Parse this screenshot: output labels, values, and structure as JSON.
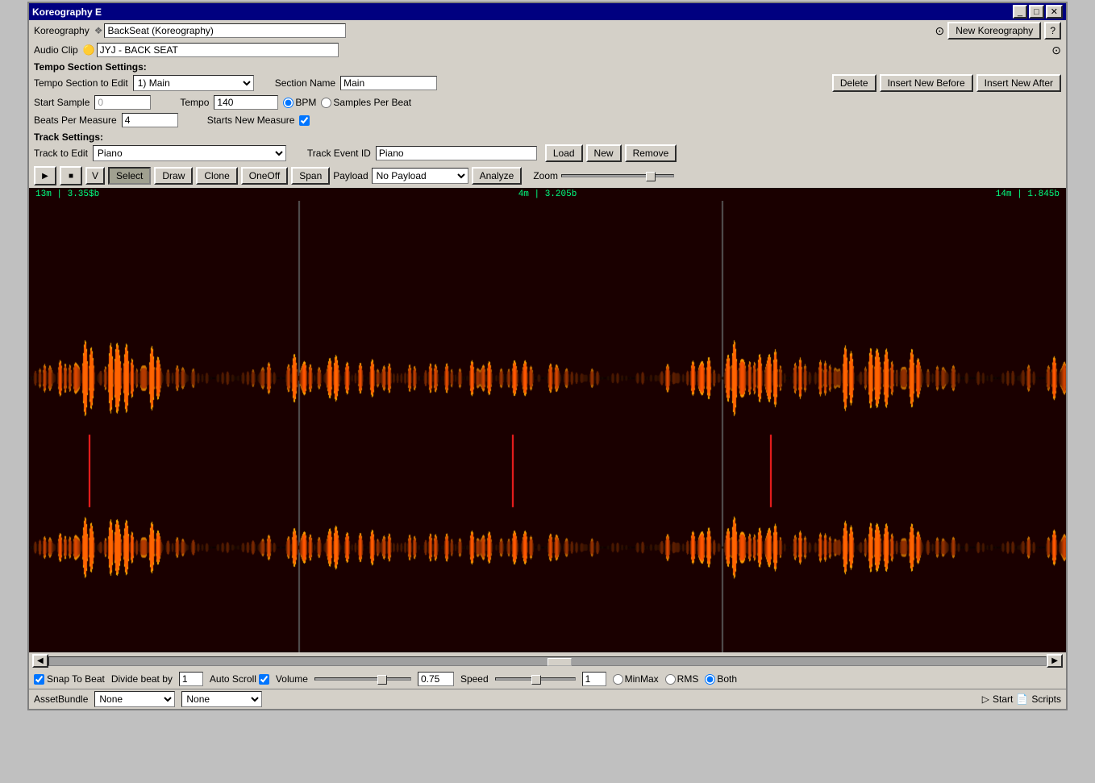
{
  "window": {
    "title": "Koreography E"
  },
  "header": {
    "koreography_label": "Koreography",
    "koreography_value": "BackSeat (Koreography)",
    "audio_clip_label": "Audio Clip",
    "audio_clip_value": "JYJ - BACK SEAT",
    "new_koreography_btn": "New Koreography",
    "question_btn": "?"
  },
  "tempo_section": {
    "title": "Tempo Section Settings:",
    "to_edit_label": "Tempo Section to Edit",
    "to_edit_value": "1) Main",
    "section_name_label": "Section Name",
    "section_name_value": "Main",
    "delete_btn": "Delete",
    "insert_before_btn": "Insert New Before",
    "insert_after_btn": "Insert New After",
    "start_sample_label": "Start Sample",
    "start_sample_value": "0",
    "tempo_label": "Tempo",
    "tempo_value": "140",
    "bpm_radio": "BPM",
    "spb_radio": "Samples Per Beat",
    "beats_per_measure_label": "Beats Per Measure",
    "beats_per_measure_value": "4",
    "starts_new_measure_label": "Starts New Measure",
    "starts_new_measure_checked": true
  },
  "track_settings": {
    "title": "Track Settings:",
    "to_edit_label": "Track to Edit",
    "to_edit_value": "Piano",
    "event_id_label": "Track Event ID",
    "event_id_value": "Piano",
    "load_btn": "Load",
    "new_btn": "New",
    "remove_btn": "Remove"
  },
  "toolbar": {
    "play_icon": "▶",
    "stop_icon": "■",
    "v_btn": "V",
    "select_btn": "Select",
    "draw_btn": "Draw",
    "clone_btn": "Clone",
    "oneoff_btn": "OneOff",
    "span_btn": "Span",
    "payload_label": "Payload",
    "payload_value": "No Payload",
    "analyze_btn": "Analyze",
    "zoom_label": "Zoom"
  },
  "waveform": {
    "marker_left": "13m | 3.35$b",
    "marker_center": "4m | 3.205b",
    "marker_right": "14m | 1.845b"
  },
  "bottom": {
    "snap_to_beat": "Snap To Beat",
    "divide_beat_by": "Divide beat by",
    "divide_value": "1",
    "auto_scroll": "Auto Scroll",
    "auto_scroll_checked": true,
    "volume_label": "Volume",
    "volume_value": "0.75",
    "speed_label": "Speed",
    "speed_value": "1",
    "minmax_radio": "MinMax",
    "rms_radio": "RMS",
    "both_radio": "Both",
    "both_checked": true
  },
  "status_bar": {
    "asset_bundle": "AssetBundle",
    "none1": "None",
    "none2": "None",
    "start": "Start",
    "scripts": "Scripts"
  },
  "colors": {
    "waveform_bg": "#1a0000",
    "waveform_orange": "#ff8800",
    "waveform_bright": "#ffcc00",
    "marker_color": "#00ff80",
    "divider_color": "#555555",
    "beat_red": "#ff0000"
  }
}
